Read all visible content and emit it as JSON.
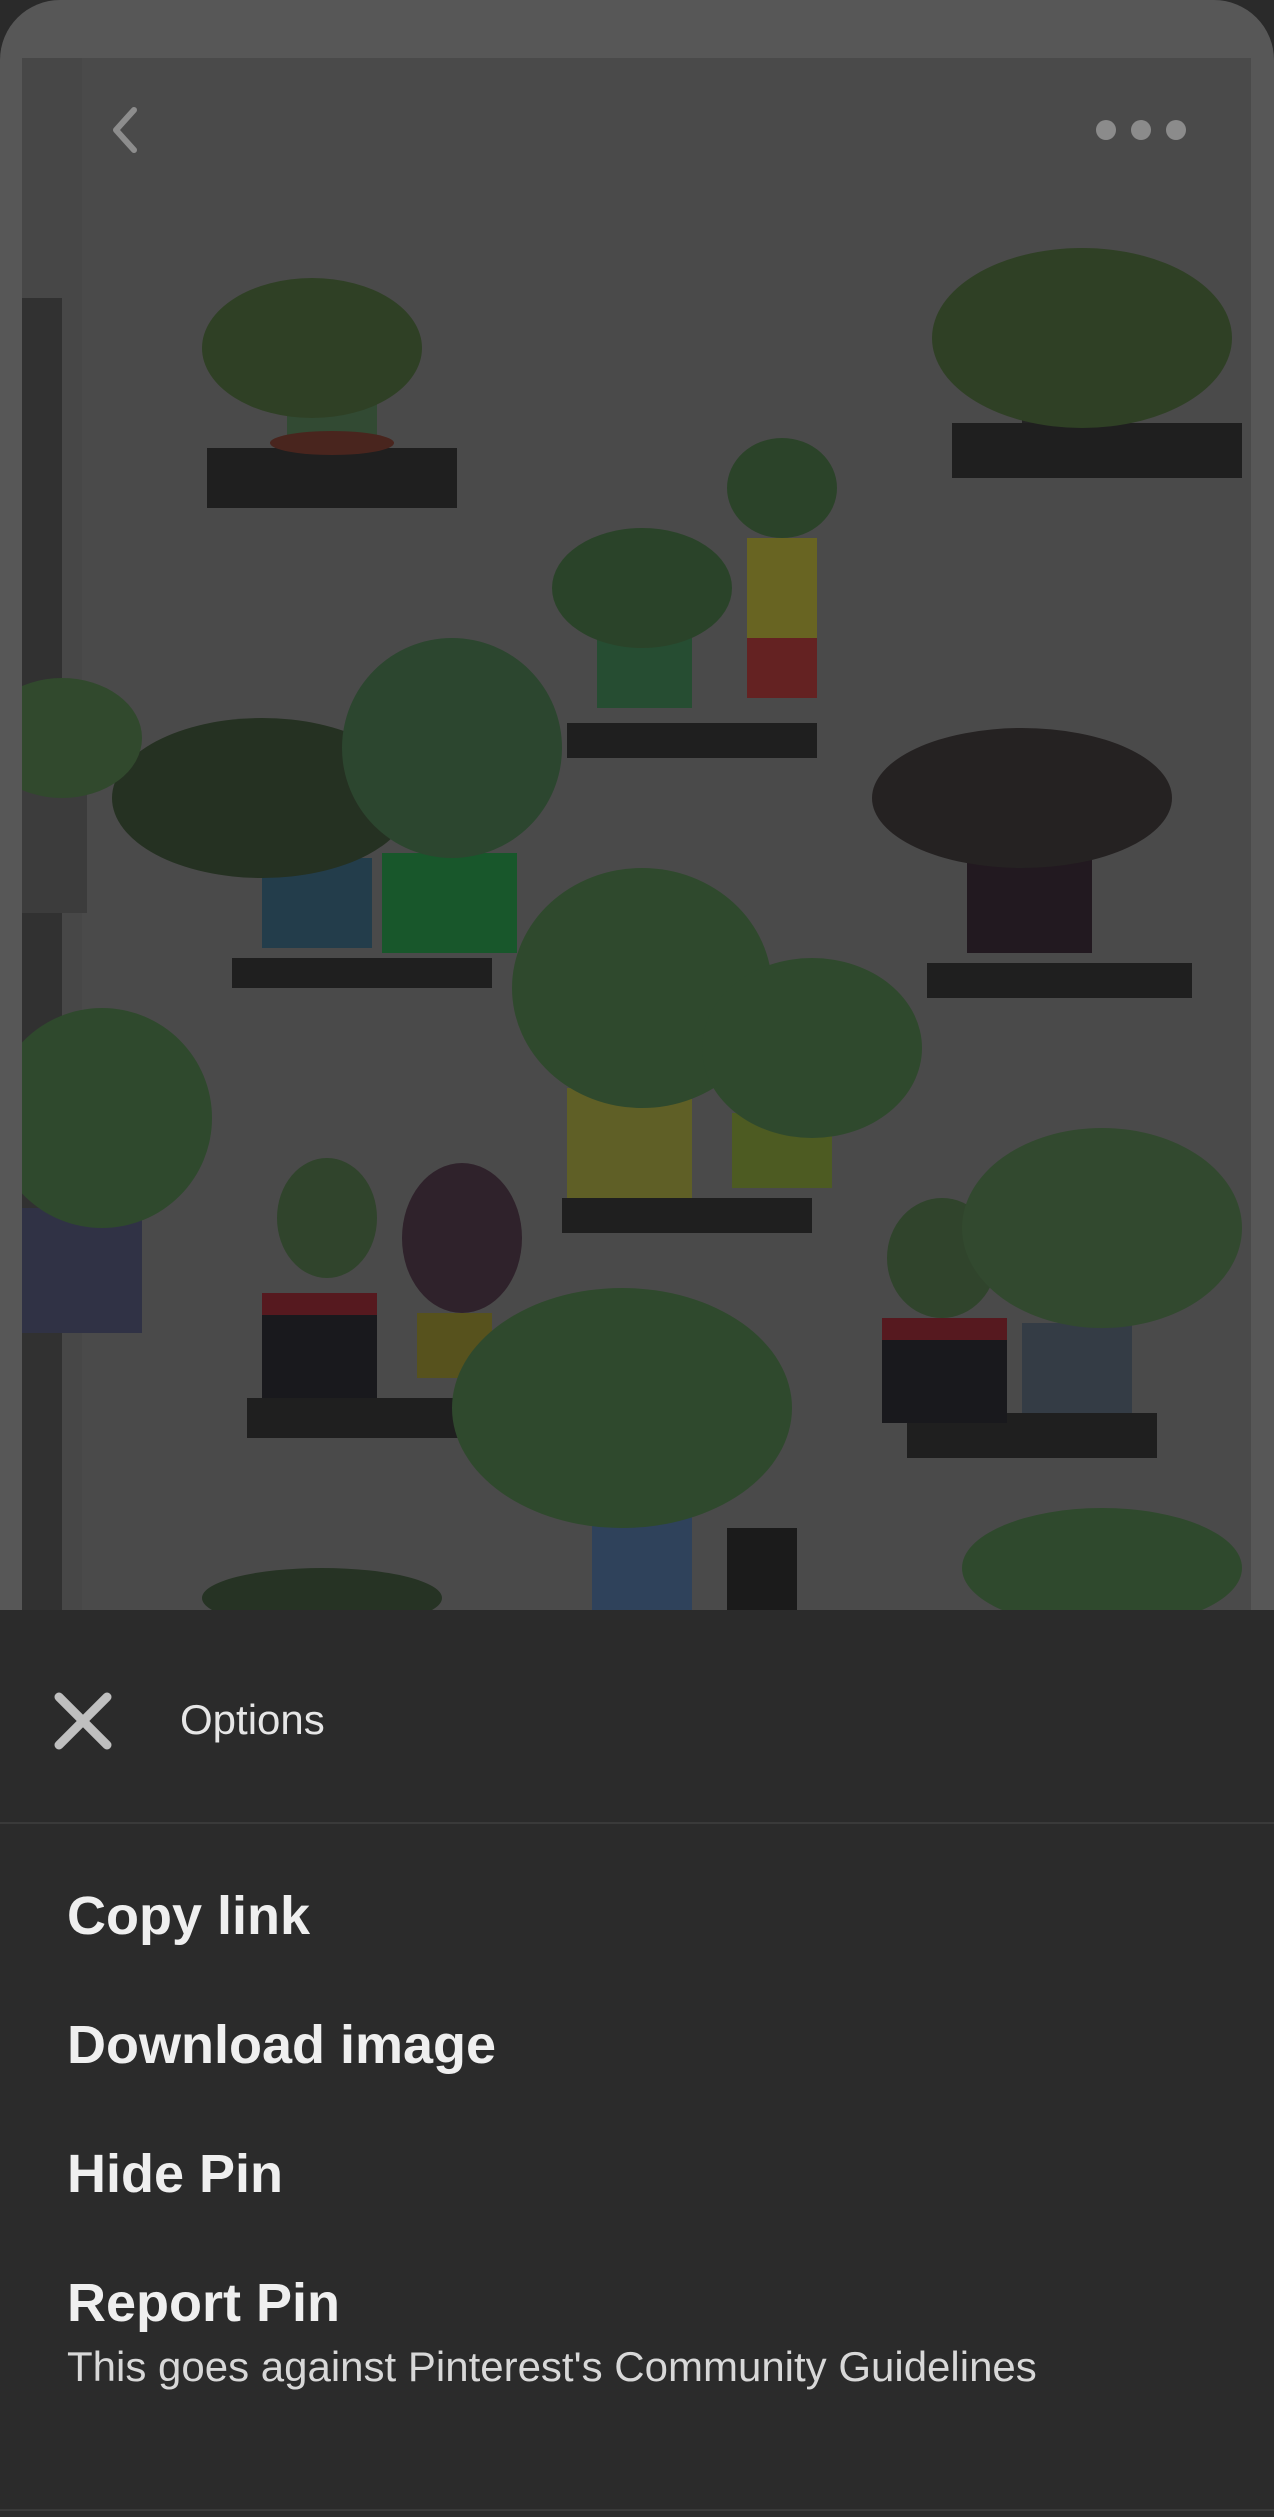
{
  "header": {
    "back_icon": "chevron-left-icon",
    "more_icon": "more-horizontal-icon"
  },
  "pin": {
    "image_description_icon": "plant-wall-photo"
  },
  "sheet": {
    "title": "Options",
    "close_icon": "close-icon",
    "items": [
      {
        "label": "Copy link"
      },
      {
        "label": "Download image"
      },
      {
        "label": "Hide Pin"
      },
      {
        "label": "Report Pin",
        "subtitle": "This goes against Pinterest's Community Guidelines"
      }
    ]
  },
  "colors": {
    "sheet_bg": "#2b2b2b",
    "text_primary": "#efefef"
  }
}
